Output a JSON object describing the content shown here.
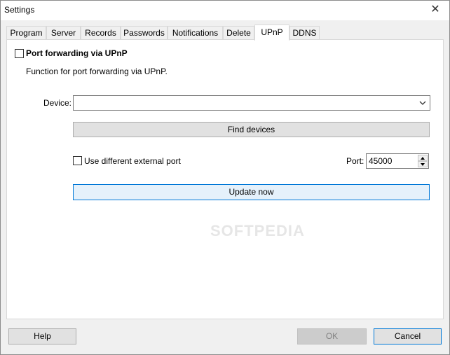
{
  "window": {
    "title": "Settings",
    "close_glyph": "✕"
  },
  "tabs": [
    {
      "label": "Program"
    },
    {
      "label": "Server"
    },
    {
      "label": "Records"
    },
    {
      "label": "Passwords"
    },
    {
      "label": "Notifications"
    },
    {
      "label": "Delete"
    },
    {
      "label": "UPnP",
      "active": true
    },
    {
      "label": "DDNS"
    }
  ],
  "upnp": {
    "enable_label": "Port forwarding via UPnP",
    "enable_checked": false,
    "description": "Function for port forwarding via UPnP.",
    "device_label": "Device:",
    "device_value": "",
    "find_devices_label": "Find devices",
    "external_port_label": "Use different external port",
    "external_port_checked": false,
    "port_label": "Port:",
    "port_value": "45000",
    "update_now_label": "Update now"
  },
  "footer": {
    "help_label": "Help",
    "ok_label": "OK",
    "cancel_label": "Cancel"
  },
  "watermark": "SOFTPEDIA"
}
